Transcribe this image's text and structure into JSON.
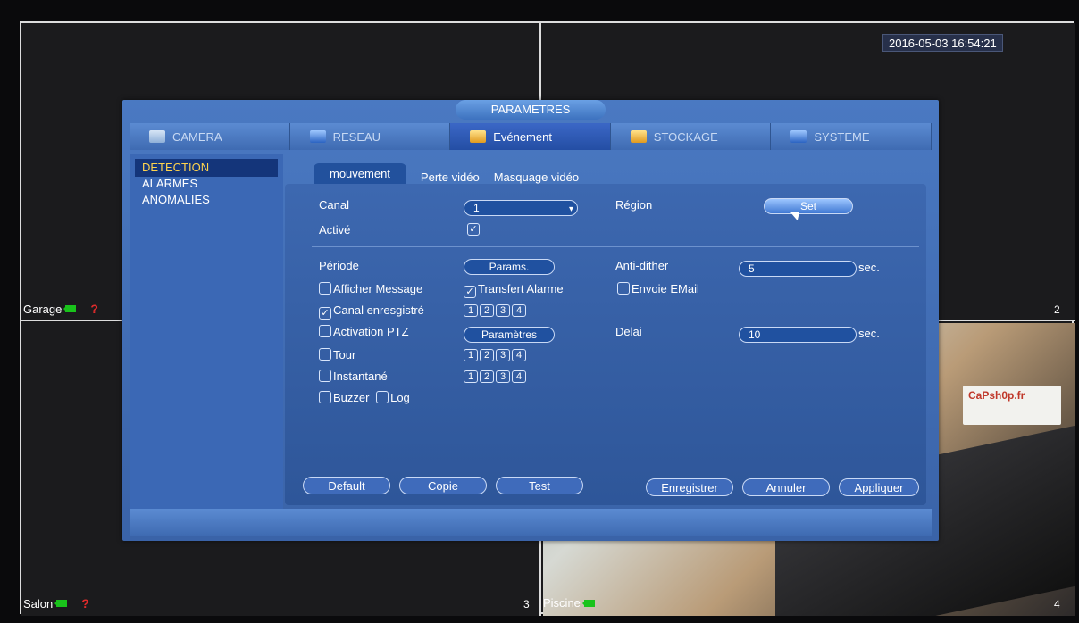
{
  "clock": "2016-05-03 16:54:21",
  "cameras": {
    "garage": {
      "label": "Garage",
      "number": ""
    },
    "cam2": {
      "number": "2"
    },
    "salon": {
      "label": "Salon",
      "number": "3"
    },
    "piscine": {
      "label": "Piscine",
      "number": "4"
    },
    "status_icon": "?"
  },
  "sign_text": "CaPsh0p.fr",
  "dialog": {
    "title": "PARAMETRES",
    "tabs": [
      "CAMERA",
      "RESEAU",
      "Evénement",
      "STOCKAGE",
      "SYSTEME"
    ],
    "active_tab": "Evénement",
    "sidebar": [
      "DETECTION",
      "ALARMES",
      "ANOMALIES"
    ],
    "subtabs": [
      "mouvement",
      "Perte vidéo",
      "Masquage vidéo"
    ],
    "form": {
      "canal_label": "Canal",
      "canal_value": "1",
      "region_label": "Région",
      "region_button": "Set",
      "active_label": "Activé",
      "periode_label": "Période",
      "params_button": "Params.",
      "antidither_label": "Anti-dither",
      "antidither_value": "5",
      "sec1": "sec.",
      "afficher_message": "Afficher Message",
      "transfert_alarme": "Transfert Alarme",
      "envoie_email": "Envoie EMail",
      "canal_enregistre": "Canal enresgistré",
      "activation_ptz": "Activation PTZ",
      "parametres_button": "Paramètres",
      "delai_label": "Delai",
      "delai_value": "10",
      "sec2": "sec.",
      "tour": "Tour",
      "instantane": "Instantané",
      "buzzer": "Buzzer",
      "log": "Log",
      "channels": [
        "1",
        "2",
        "3",
        "4"
      ]
    },
    "buttons": {
      "default": "Default",
      "copie": "Copie",
      "test": "Test",
      "enregistrer": "Enregistrer",
      "annuler": "Annuler",
      "appliquer": "Appliquer"
    }
  }
}
